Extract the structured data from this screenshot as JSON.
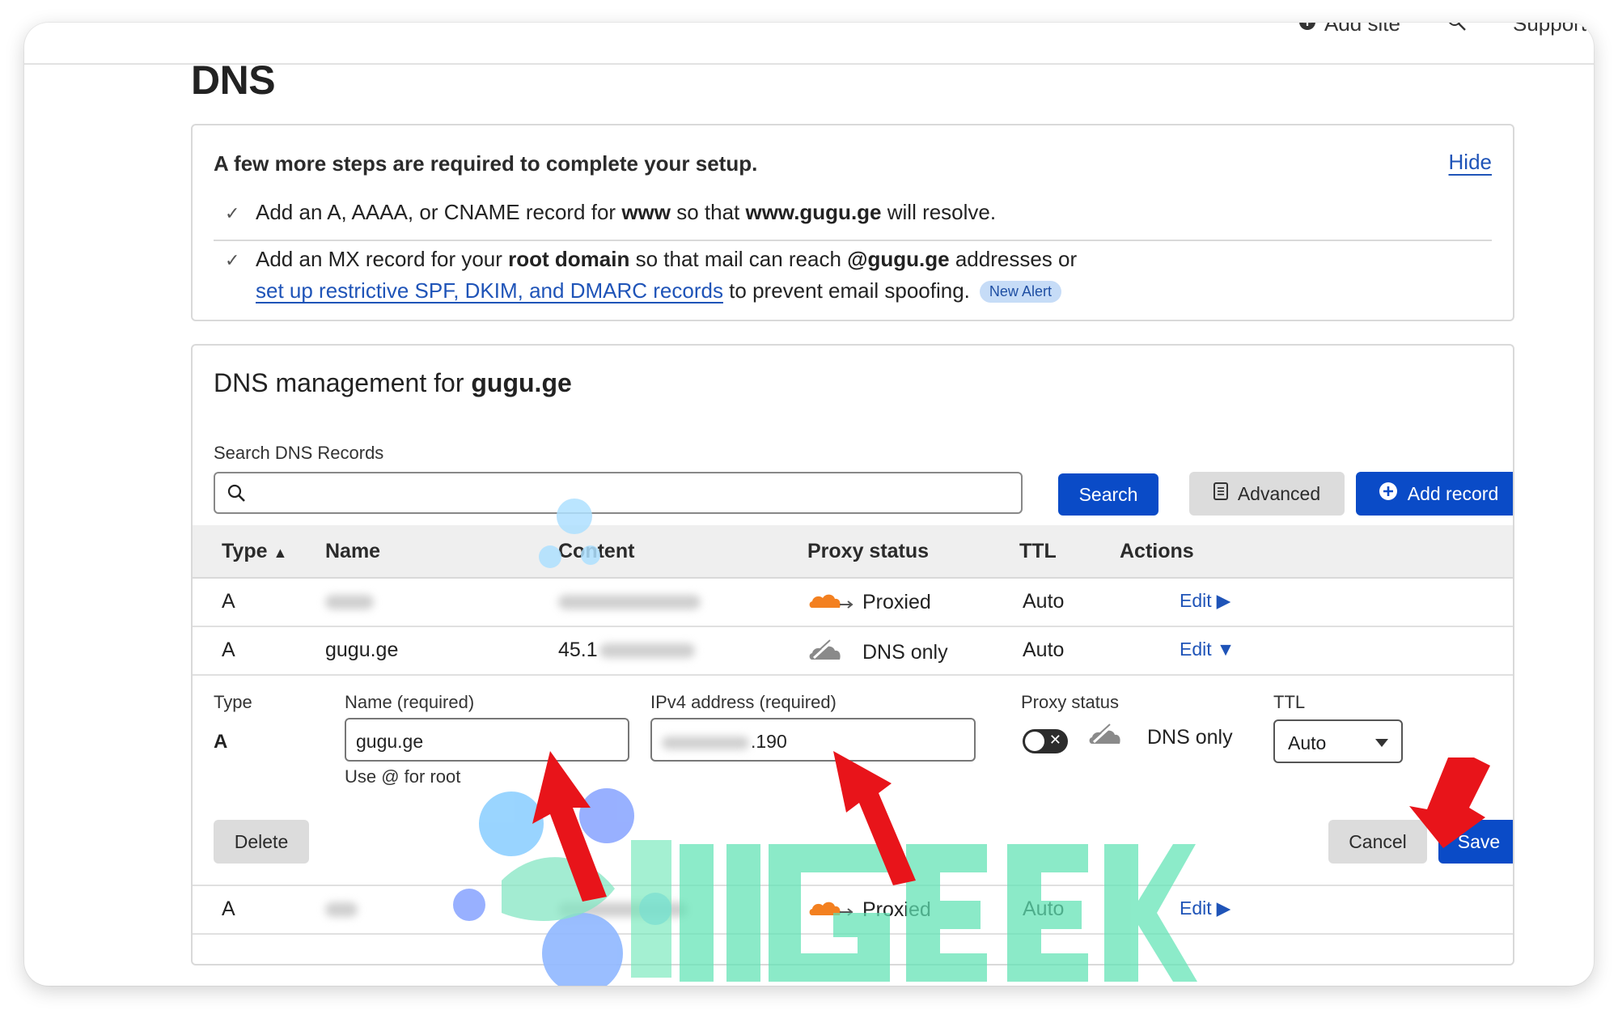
{
  "topbar": {
    "add_site": "Add site",
    "support": "Support"
  },
  "page": {
    "title": "DNS"
  },
  "setup": {
    "heading": "A few more steps are required to complete your setup.",
    "hide": "Hide",
    "step1": {
      "pre": "Add an A, AAAA, or CNAME record for ",
      "b1": "www",
      "mid": " so that ",
      "b2": "www.gugu.ge",
      "post": " will resolve."
    },
    "step2": {
      "pre": "Add an MX record for your ",
      "b1": "root domain",
      "mid": " so that mail can reach ",
      "b2": "@gugu.ge",
      "post": " addresses or"
    },
    "step2b": {
      "link": "set up restrictive SPF, DKIM, and DMARC records",
      "post": " to prevent email spoofing.",
      "badge": "New Alert"
    }
  },
  "mgmt": {
    "title_pre": "DNS management for ",
    "title_domain": "gugu.ge",
    "search_label": "Search DNS Records",
    "search_btn": "Search",
    "advanced_btn": "Advanced",
    "add_btn": "Add record"
  },
  "table": {
    "headers": {
      "type": "Type",
      "name": "Name",
      "content": "Content",
      "proxy": "Proxy status",
      "ttl": "TTL",
      "actions": "Actions"
    },
    "rows": [
      {
        "type": "A",
        "name": "",
        "content": "",
        "proxy": "Proxied",
        "ttl": "Auto",
        "action": "Edit"
      },
      {
        "type": "A",
        "name": "gugu.ge",
        "content": "45.1",
        "proxy": "DNS only",
        "ttl": "Auto",
        "action": "Edit"
      },
      {
        "type": "A",
        "name": "",
        "content": "",
        "proxy": "Proxied",
        "ttl": "Auto",
        "action": "Edit"
      }
    ]
  },
  "edit_form": {
    "type_label": "Type",
    "type_value": "A",
    "name_label": "Name (required)",
    "name_value": "gugu.ge",
    "name_hint": "Use @ for root",
    "ip_label": "IPv4 address (required)",
    "ip_value": ".190",
    "proxy_label": "Proxy status",
    "proxy_value": "DNS only",
    "ttl_label": "TTL",
    "ttl_value": "Auto",
    "delete_btn": "Delete",
    "cancel_btn": "Cancel",
    "save_btn": "Save"
  },
  "colors": {
    "primary": "#0a4bc7",
    "link": "#1f54b8",
    "proxied": "#f38020",
    "dns_only": "#8a8a8a",
    "annotation": "#e8141a",
    "watermark": "#5fe3b4"
  }
}
